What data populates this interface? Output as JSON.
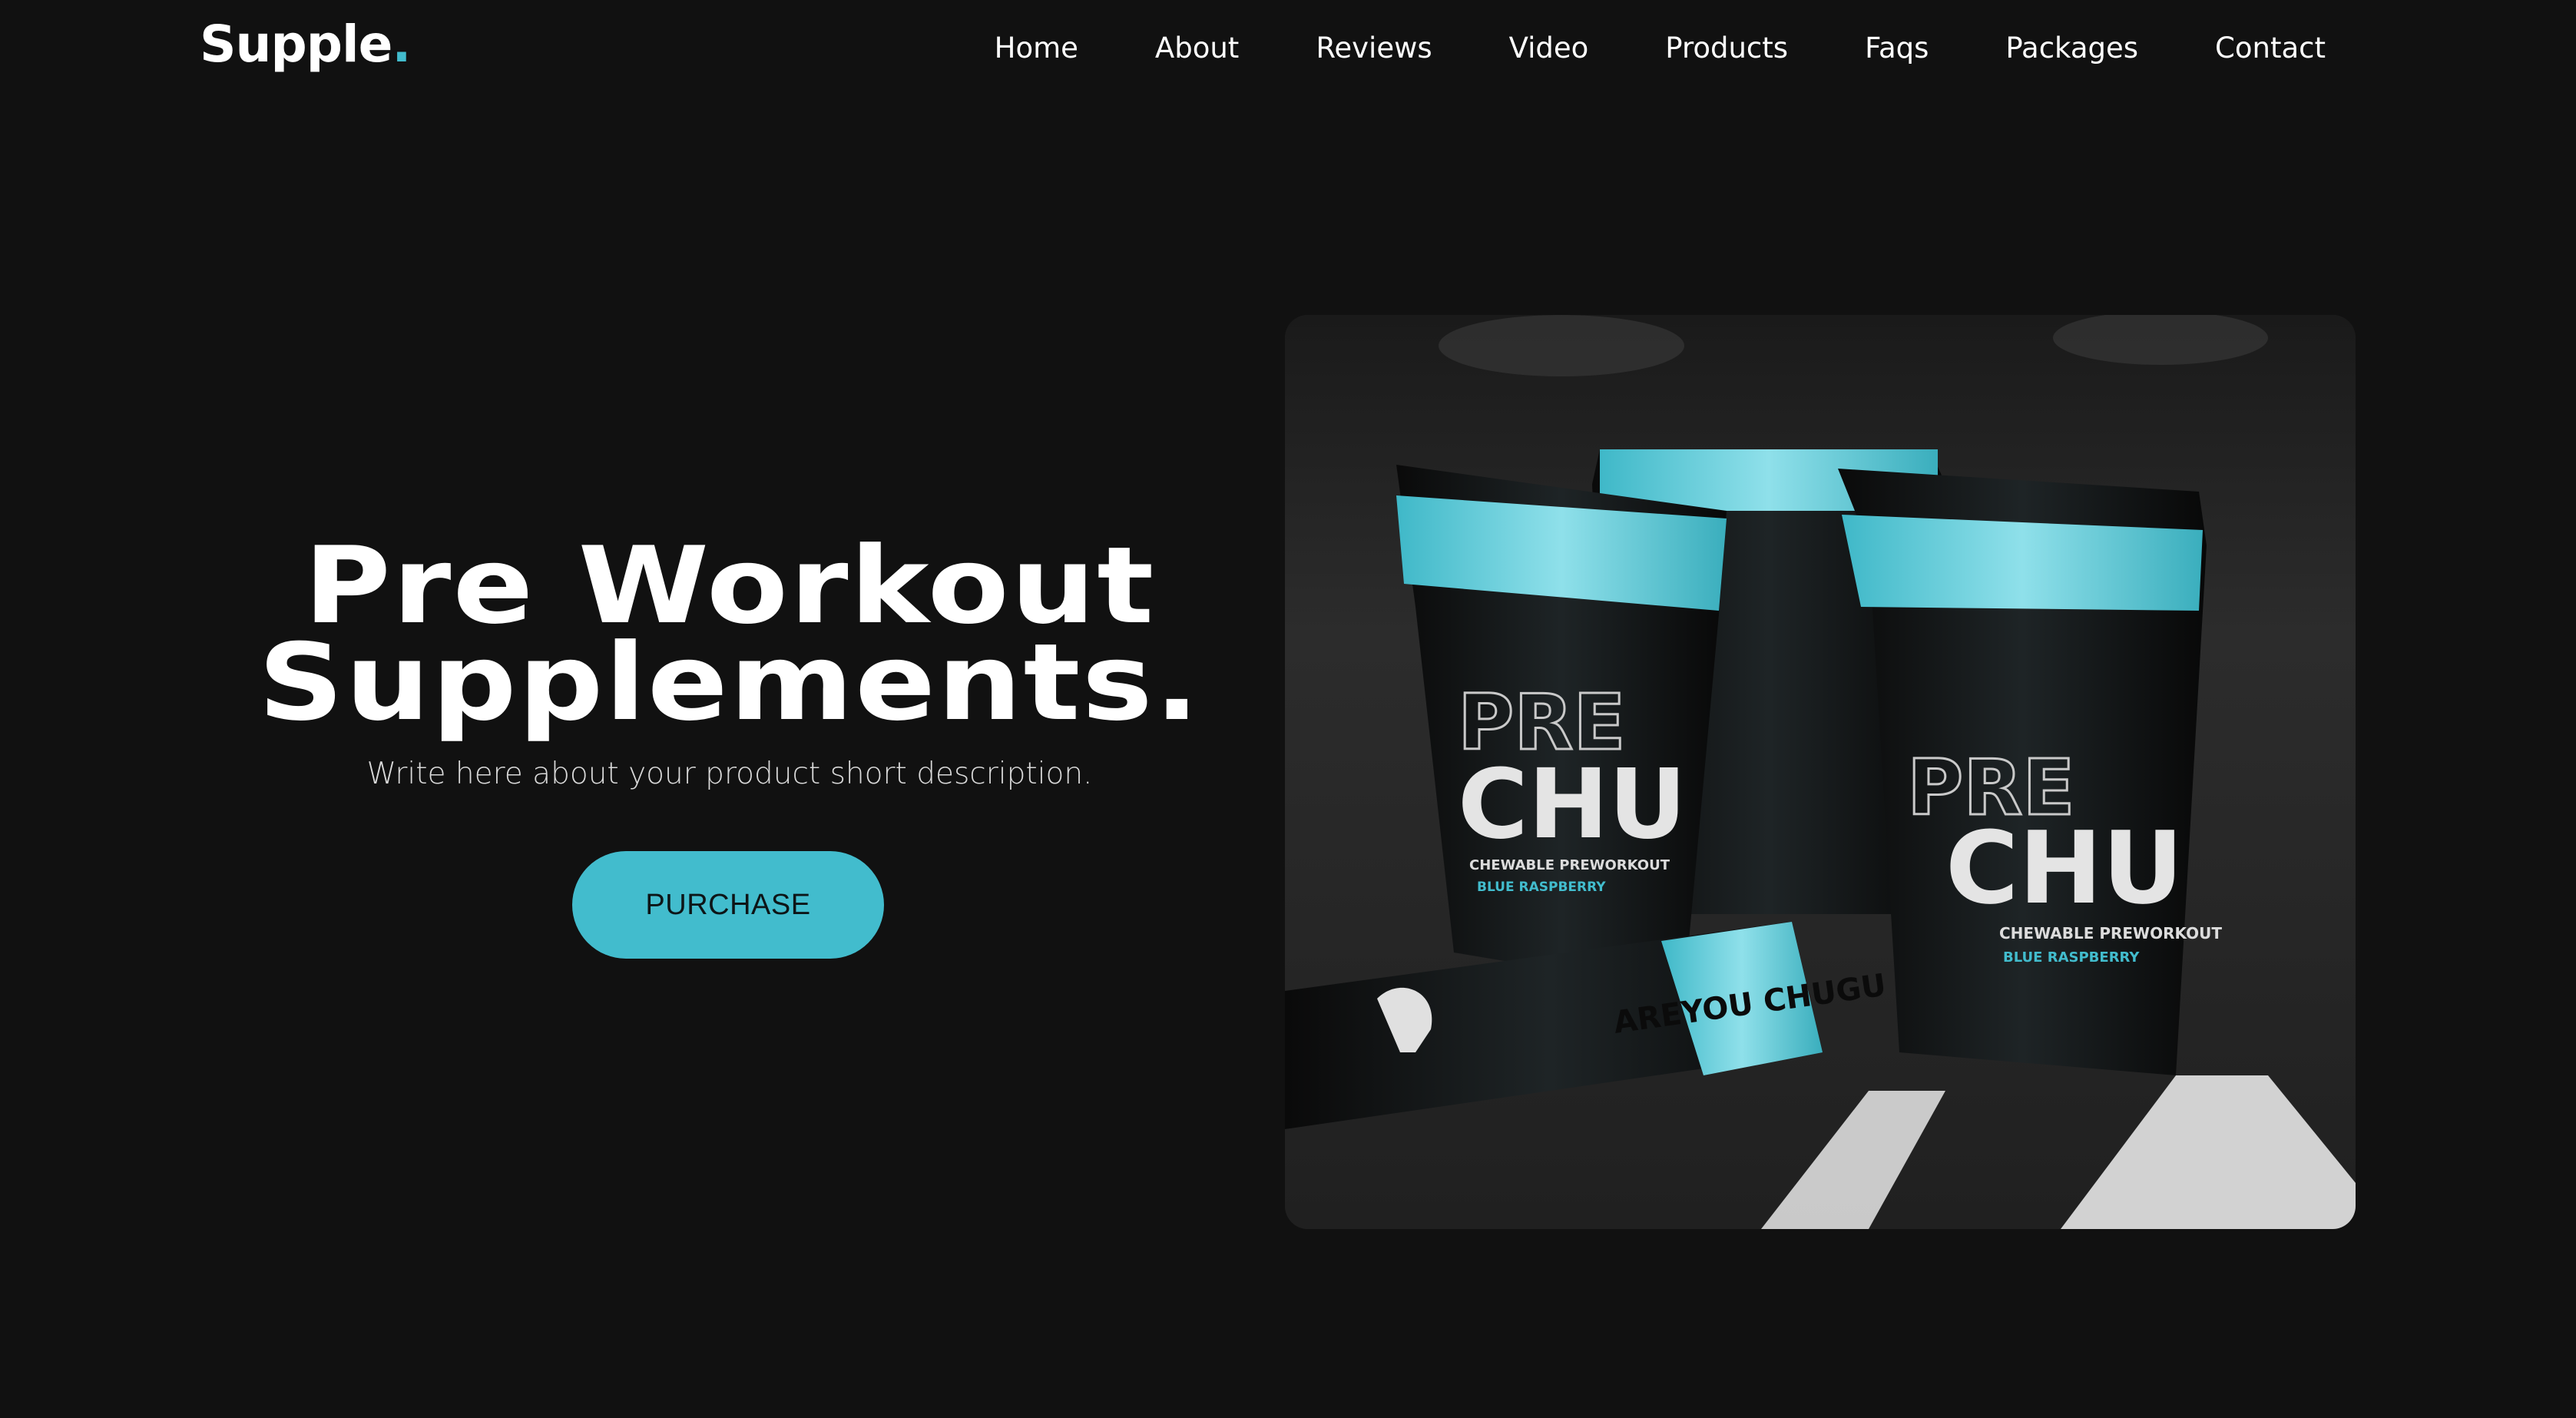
{
  "header": {
    "logo_text": "Supple",
    "logo_dot": ".",
    "nav": [
      {
        "label": "Home"
      },
      {
        "label": "About"
      },
      {
        "label": "Reviews"
      },
      {
        "label": "Video"
      },
      {
        "label": "Products"
      },
      {
        "label": "Faqs"
      },
      {
        "label": "Packages"
      },
      {
        "label": "Contact"
      }
    ]
  },
  "hero": {
    "title_line1": "Pre Workout",
    "title_line2": "Supplements.",
    "description": "Write here about your product short description.",
    "cta_label": "PURCHASE"
  },
  "product_image": {
    "brand_line1": "PRE",
    "brand_line2": "CHU",
    "tagline": "CHEWABLE PREWORKOUT",
    "flavor": "BLUE RASPBERRY",
    "fallen_pack_text": "AREYOU CHUGU"
  },
  "colors": {
    "background": "#111111",
    "accent": "#42bccd",
    "text": "#ffffff"
  }
}
